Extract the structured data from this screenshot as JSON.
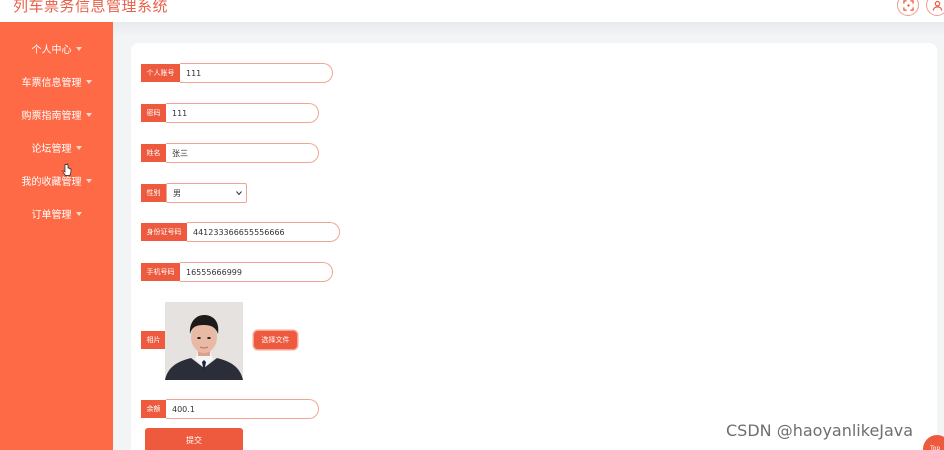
{
  "app": {
    "title": "列车票务信息管理系统"
  },
  "header": {
    "icons": [
      "fullscreen-icon",
      "user-icon"
    ]
  },
  "sidebar": {
    "items": [
      {
        "label": "个人中心"
      },
      {
        "label": "车票信息管理"
      },
      {
        "label": "购票指南管理"
      },
      {
        "label": "论坛管理"
      },
      {
        "label": "我的收藏管理"
      },
      {
        "label": "订单管理"
      }
    ]
  },
  "form": {
    "account": {
      "label": "个人账号",
      "value": "111"
    },
    "password": {
      "label": "密码",
      "value": "111"
    },
    "name": {
      "label": "姓名",
      "value": "张三"
    },
    "gender": {
      "label": "性别",
      "value": "男"
    },
    "id_number": {
      "label": "身份证号码",
      "value": "441233366655556666"
    },
    "phone": {
      "label": "手机号码",
      "value": "16555666999"
    },
    "photo": {
      "label": "相片",
      "button": "选择文件"
    },
    "balance": {
      "label": "余额",
      "value": "400.1"
    },
    "submit": "提交"
  },
  "watermark": "CSDN @haoyanlikeJava",
  "top_button": "Top",
  "colors": {
    "accent": "#ee5a3e",
    "sidebar": "#ff6a46",
    "title": "#e8604a"
  }
}
